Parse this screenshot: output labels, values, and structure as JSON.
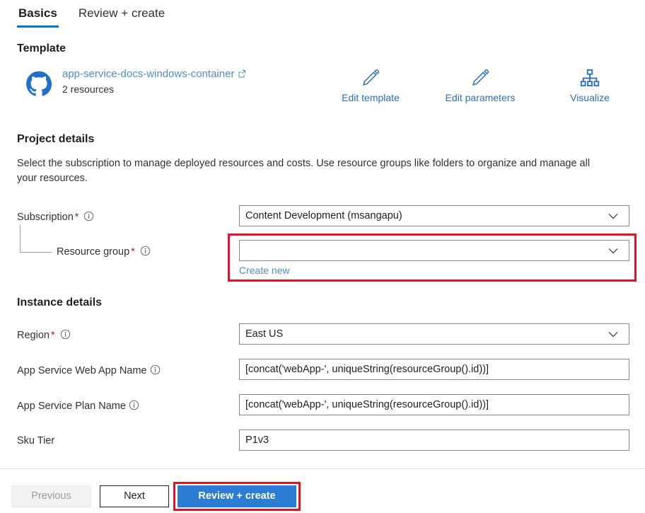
{
  "tabs": [
    {
      "label": "Basics",
      "active": true
    },
    {
      "label": "Review + create",
      "active": false
    }
  ],
  "template": {
    "heading": "Template",
    "name": "app-service-docs-windows-container",
    "resource_count": "2 resources",
    "icon": "github-icon",
    "external_link_icon": "external-link-icon",
    "actions": [
      {
        "label": "Edit template",
        "icon": "pencil-icon"
      },
      {
        "label": "Edit parameters",
        "icon": "pencil-icon"
      },
      {
        "label": "Visualize",
        "icon": "hierarchy-icon"
      }
    ]
  },
  "project_details": {
    "heading": "Project details",
    "description": "Select the subscription to manage deployed resources and costs. Use resource groups like folders to organize and manage all your resources.",
    "subscription": {
      "label": "Subscription",
      "required": "*",
      "value": "Content Development (msangapu)"
    },
    "resource_group": {
      "label": "Resource group",
      "required": "*",
      "value": "",
      "create_new_label": "Create new"
    }
  },
  "instance_details": {
    "heading": "Instance details",
    "fields": [
      {
        "label": "Region",
        "required": "*",
        "value": "East US",
        "type": "select",
        "info": true
      },
      {
        "label": "App Service Web App Name",
        "required": "",
        "value": "[concat('webApp-', uniqueString(resourceGroup().id))]",
        "type": "text",
        "info": true
      },
      {
        "label": "App Service Plan Name",
        "required": "",
        "value": "[concat('webApp-', uniqueString(resourceGroup().id))]",
        "type": "text",
        "info": true
      },
      {
        "label": "Sku Tier",
        "required": "",
        "value": "P1v3",
        "type": "text",
        "info": false
      }
    ]
  },
  "footer": {
    "previous_label": "Previous",
    "next_label": "Next",
    "review_label": "Review + create"
  },
  "colors": {
    "accent": "#0078d4",
    "link": "#4f8ccc",
    "primary_button": "#2b7cd3",
    "highlight": "#e81123",
    "required": "#a4262c"
  }
}
